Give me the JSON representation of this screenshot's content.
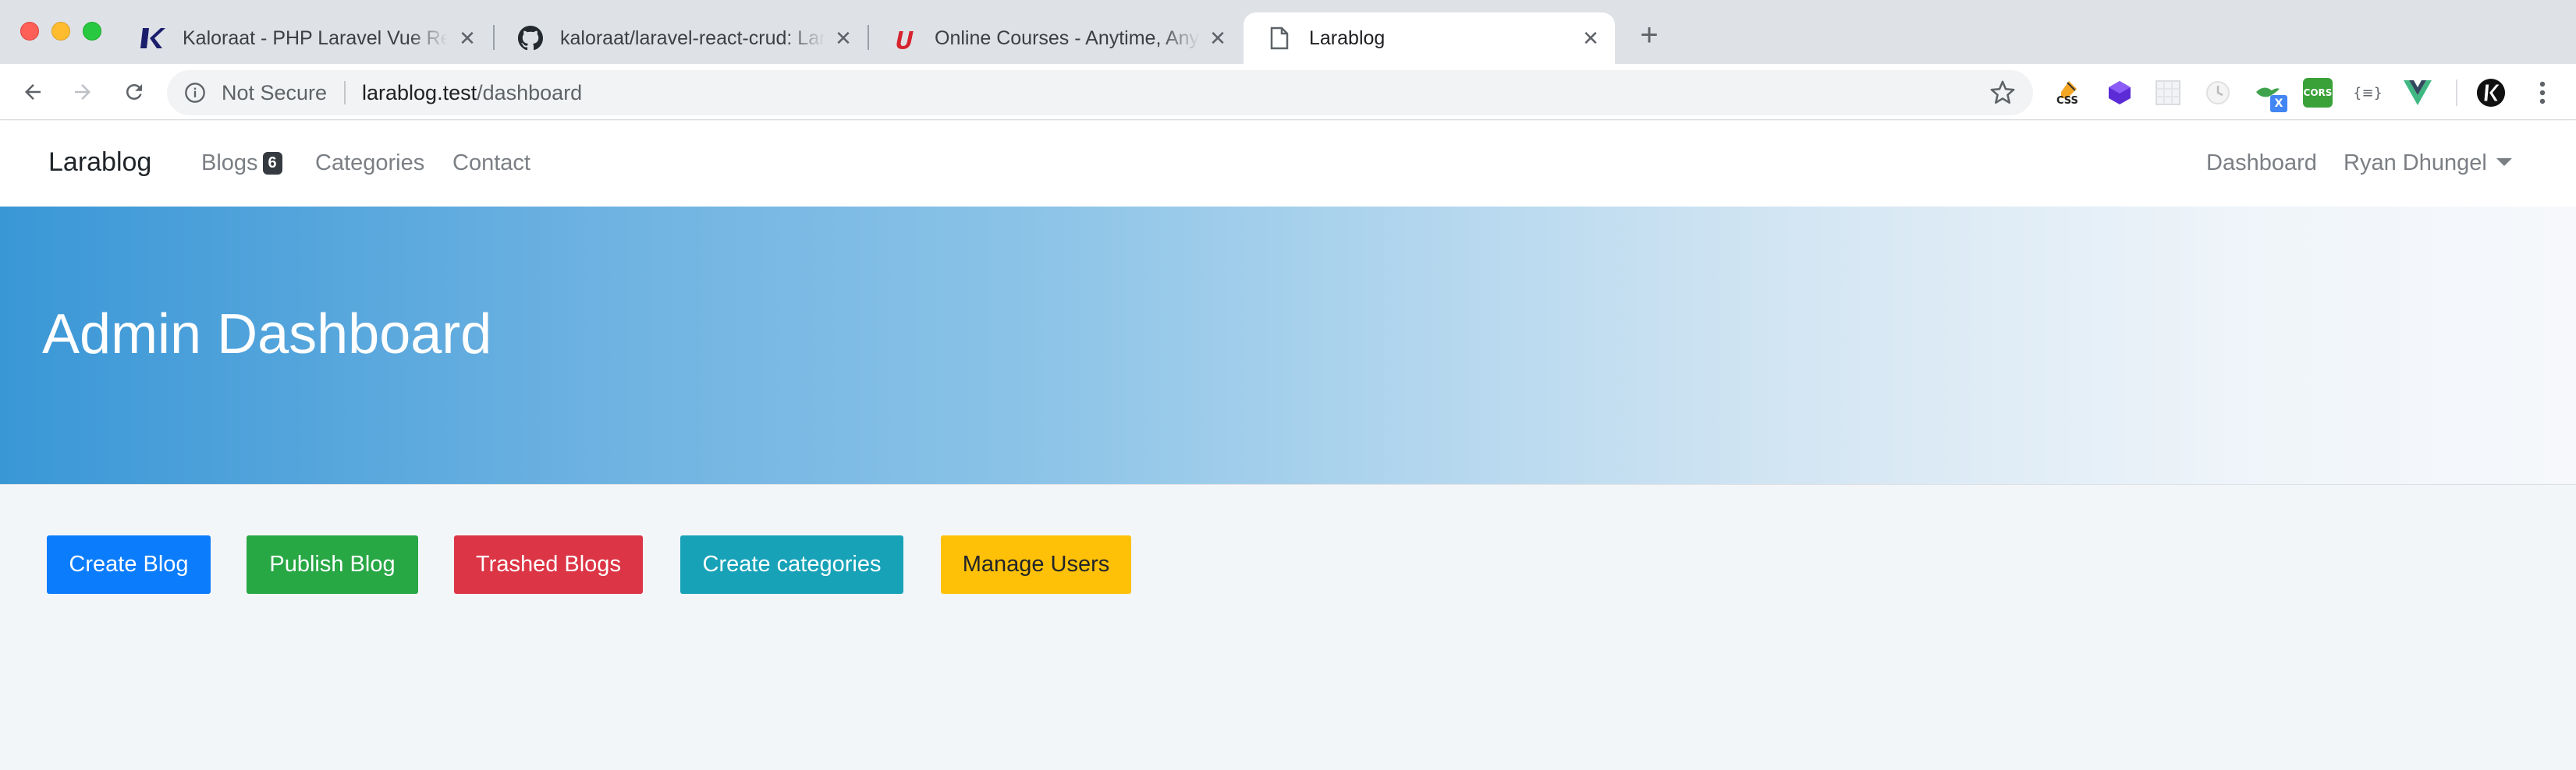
{
  "browser": {
    "tabs": [
      {
        "title": "Kaloraat - PHP Laravel Vue React",
        "state": "inactive",
        "favicon": "kaloraat-k-icon"
      },
      {
        "title": "kaloraat/laravel-react-crud: Lara",
        "state": "inactive",
        "favicon": "github-icon"
      },
      {
        "title": "Online Courses - Anytime, Anyw",
        "state": "inactive",
        "favicon": "udemy-icon"
      },
      {
        "title": "Larablog",
        "state": "active",
        "favicon": "page-icon"
      }
    ],
    "security_label": "Not Secure",
    "url_host": "larablog.test",
    "url_path": "/dashboard",
    "extensions": [
      "css-viewer-icon",
      "purple-cube-icon",
      "grid-placeholder-icon",
      "clock-icon",
      "bird-icon",
      "cors-icon",
      "json-braces-icon",
      "vue-devtools-icon",
      "k-profile-icon"
    ],
    "extension_labels": {
      "css": "CSS",
      "cors": "CORS",
      "json": "{≡}",
      "x_badge": "X"
    }
  },
  "site": {
    "brand": "Larablog",
    "nav": {
      "blogs": "Blogs",
      "blogs_count": "6",
      "categories": "Categories",
      "contact": "Contact",
      "dashboard": "Dashboard",
      "user": "Ryan Dhungel"
    }
  },
  "hero": {
    "title": "Admin Dashboard"
  },
  "actions": {
    "create_blog": "Create Blog",
    "publish_blog": "Publish Blog",
    "trashed_blogs": "Trashed Blogs",
    "create_categories": "Create categories",
    "manage_users": "Manage Users"
  },
  "colors": {
    "primary": "#0b7cfc",
    "success": "#28a745",
    "danger": "#dc3545",
    "info": "#17a2b8",
    "warning": "#ffc107",
    "hero_start": "#3a97d6"
  }
}
